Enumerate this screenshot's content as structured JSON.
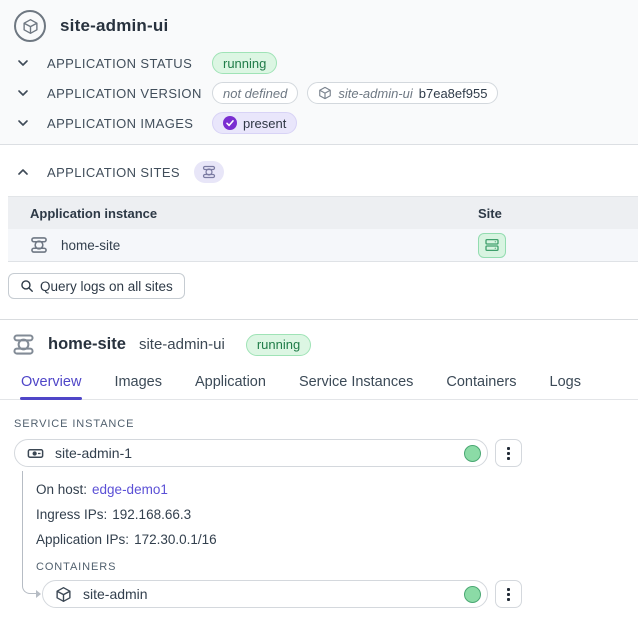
{
  "app": {
    "title": "site-admin-ui",
    "status_label": "APPLICATION STATUS",
    "status_value": "running",
    "version_label": "APPLICATION VERSION",
    "version_not_defined": "not defined",
    "version_image_name": "site-admin-ui",
    "version_image_hash": "b7ea8ef955",
    "images_label": "APPLICATION IMAGES",
    "images_value": "present"
  },
  "sites": {
    "section_label": "APPLICATION SITES",
    "columns": {
      "instance": "Application instance",
      "site": "Site"
    },
    "rows": [
      {
        "instance": "home-site"
      }
    ],
    "query_button_label": "Query logs on all sites"
  },
  "site_detail": {
    "name": "home-site",
    "app": "site-admin-ui",
    "status": "running",
    "tabs": [
      {
        "label": "Overview",
        "active": true
      },
      {
        "label": "Images",
        "active": false
      },
      {
        "label": "Application",
        "active": false
      },
      {
        "label": "Service Instances",
        "active": false
      },
      {
        "label": "Containers",
        "active": false
      },
      {
        "label": "Logs",
        "active": false
      }
    ],
    "overview": {
      "service_instance_label": "SERVICE INSTANCE",
      "instance_name": "site-admin-1",
      "on_host_label": "On host:",
      "on_host_value": "edge-demo1",
      "ingress_label": "Ingress IPs:",
      "ingress_value": "192.168.66.3",
      "app_ips_label": "Application IPs:",
      "app_ips_value": "172.30.0.1/16",
      "containers_label": "CONTAINERS",
      "container_name": "site-admin"
    }
  },
  "colors": {
    "accent_purple": "#4f46c8",
    "link_purple": "#5b50d6",
    "badge_green_bg": "#dcf6e3",
    "badge_green_text": "#1f7c48",
    "badge_purple_bg": "#e9e6fb",
    "check_purple": "#7a2ed1",
    "status_dot_green": "#8bdba6",
    "site_chip_green": "#3f9f6c"
  }
}
